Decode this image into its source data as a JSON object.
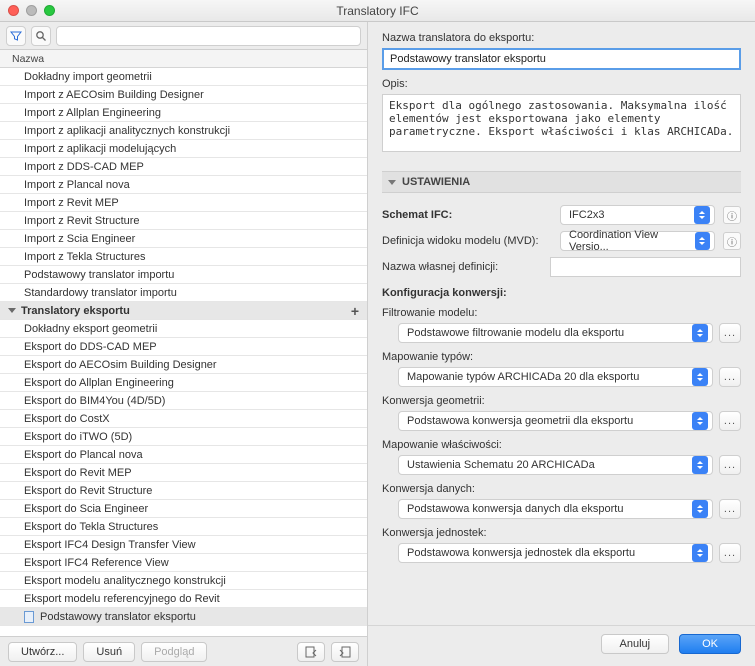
{
  "window": {
    "title": "Translatory IFC"
  },
  "left": {
    "header": "Nazwa",
    "search_placeholder": "",
    "import_items": [
      "Dokładny import geometrii",
      "Import z AECOsim Building Designer",
      "Import z Allplan Engineering",
      "Import z aplikacji analitycznych konstrukcji",
      "Import z aplikacji modelujących",
      "Import z DDS-CAD MEP",
      "Import z Plancal nova",
      "Import z Revit MEP",
      "Import z Revit Structure",
      "Import z Scia Engineer",
      "Import z Tekla Structures",
      "Podstawowy translator importu",
      "Standardowy translator importu"
    ],
    "export_group": "Translatory eksportu",
    "export_items": [
      "Dokładny eksport geometrii",
      "Eksport do  DDS-CAD MEP",
      "Eksport do AECOsim Building Designer",
      "Eksport do Allplan Engineering",
      "Eksport do BIM4You (4D/5D)",
      "Eksport do CostX",
      "Eksport do iTWO (5D)",
      "Eksport do Plancal nova",
      "Eksport do Revit MEP",
      "Eksport do Revit Structure",
      "Eksport do Scia Engineer",
      "Eksport do Tekla Structures",
      "Eksport IFC4 Design Transfer View",
      "Eksport IFC4 Reference View",
      "Eksport modelu analitycznego konstrukcji",
      "Eksport modelu referencyjnego do Revit",
      "Podstawowy translator eksportu"
    ],
    "selected_index": 16,
    "buttons": {
      "create": "Utwórz...",
      "delete": "Usuń",
      "preview": "Podgląd"
    }
  },
  "right": {
    "name_label": "Nazwa translatora do eksportu:",
    "name_value": "Podstawowy translator eksportu",
    "desc_label": "Opis:",
    "desc_value": "Eksport dla ogólnego zastosowania. Maksymalna ilość elementów jest eksportowana jako elementy parametryczne. Eksport właściwości i klas ARCHICADa.",
    "settings_header": "USTAWIENIA",
    "schema_label": "Schemat IFC:",
    "schema_value": "IFC2x3",
    "mvd_label": "Definicja widoku modelu (MVD):",
    "mvd_value": "Coordination View Versio...",
    "own_def_label": "Nazwa własnej definicji:",
    "own_def_value": "",
    "config_header": "Konfiguracja konwersji:",
    "filter_label": "Filtrowanie modelu:",
    "filter_value": "Podstawowe filtrowanie modelu dla eksportu",
    "typemap_label": "Mapowanie typów:",
    "typemap_value": "Mapowanie typów ARCHICADa 20 dla eksportu",
    "geom_label": "Konwersja geometrii:",
    "geom_value": "Podstawowa konwersja geometrii dla eksportu",
    "propmap_label": "Mapowanie właściwości:",
    "propmap_value": "Ustawienia Schematu 20 ARCHICADa",
    "dataconv_label": "Konwersja danych:",
    "dataconv_value": "Podstawowa konwersja danych dla eksportu",
    "unitconv_label": "Konwersja jednostek:",
    "unitconv_value": "Podstawowa konwersja jednostek dla eksportu"
  },
  "footer": {
    "cancel": "Anuluj",
    "ok": "OK"
  }
}
